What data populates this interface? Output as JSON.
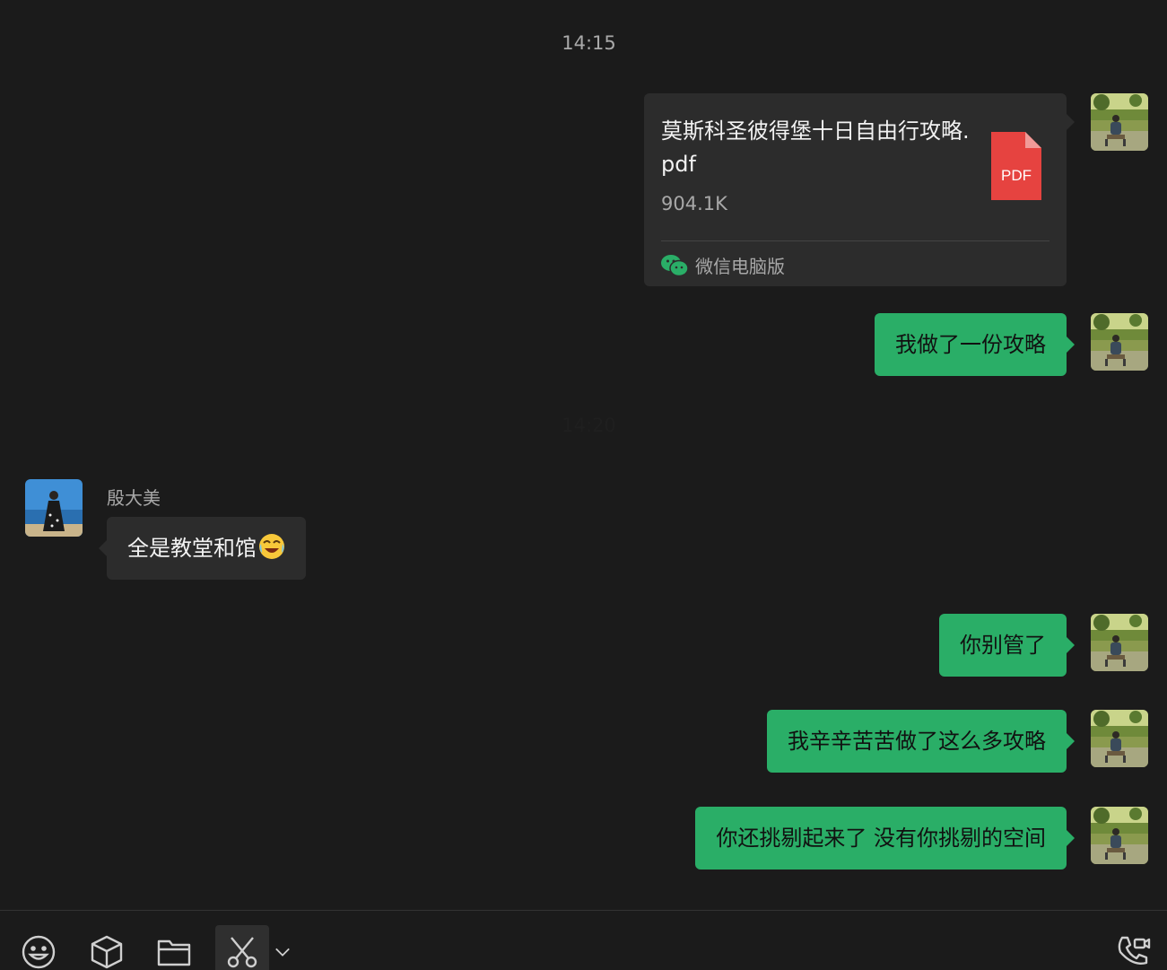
{
  "chat": {
    "timestamp": "14:15",
    "hidden_timestamp": "14:20",
    "file_message": {
      "file_name": "莫斯科圣彼得堡十日自由行攻略.pdf",
      "file_size": "904.1K",
      "file_type_label": "PDF",
      "source_label": "微信电脑版"
    },
    "messages": [
      {
        "sender": "me",
        "text": "我做了一份攻略"
      },
      {
        "sender": "other",
        "name": "殷大美",
        "text": "全是教堂和馆"
      },
      {
        "sender": "me",
        "text": "你别管了"
      },
      {
        "sender": "me",
        "text": "我辛辛苦苦做了这么多攻略"
      },
      {
        "sender": "me",
        "text": "你还挑剔起来了 没有你挑剔的空间"
      }
    ]
  },
  "toolbar": {
    "icons": [
      "emoji-icon",
      "sticker-box-icon",
      "folder-icon",
      "screenshot-scissors-icon",
      "chevron-down-icon",
      "voice-video-call-icon"
    ]
  },
  "colors": {
    "background": "#1b1b1b",
    "outgoing_bubble": "#2aae67",
    "incoming_bubble": "#2c2c2c",
    "pdf_red": "#e64340",
    "wechat_green": "#2aae67"
  }
}
